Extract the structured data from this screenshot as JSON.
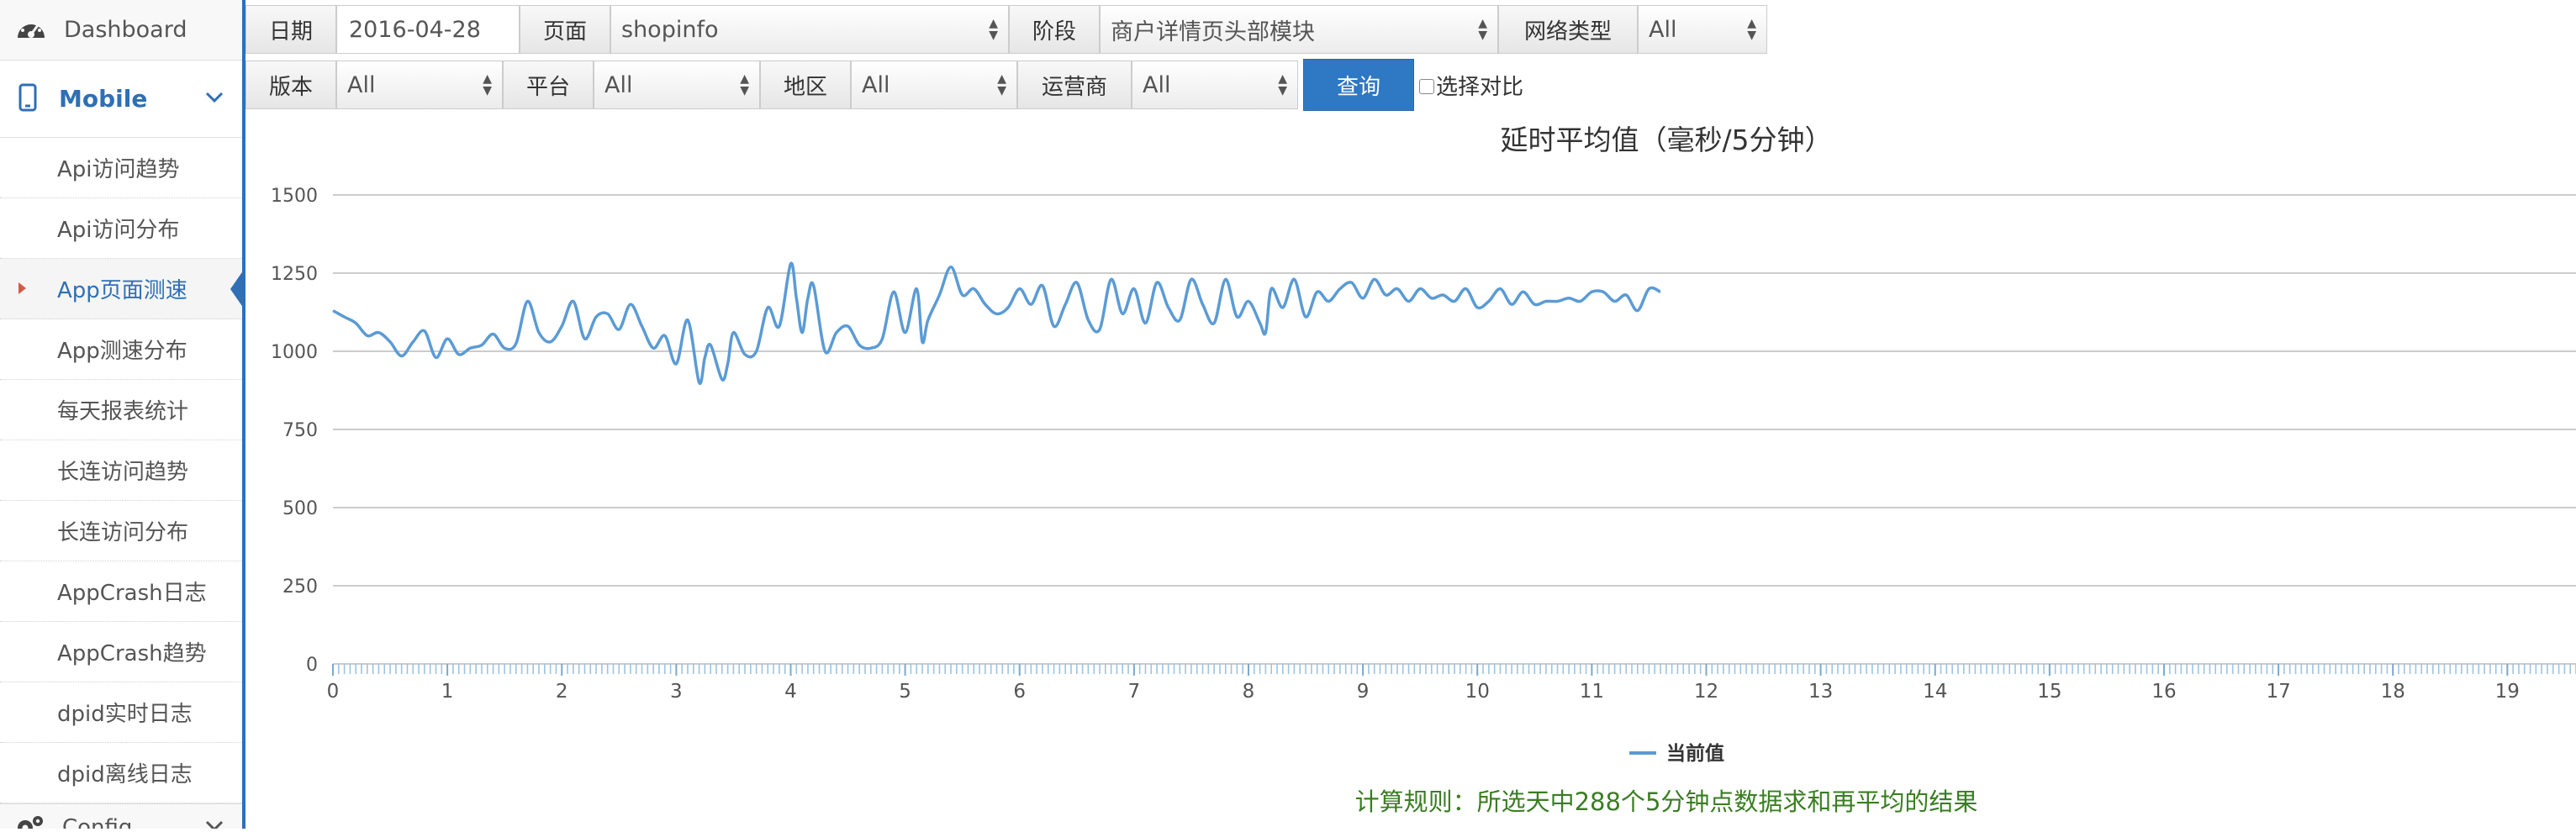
{
  "sidebar": {
    "dashboard": {
      "label": "Dashboard",
      "icon": "dashboard-icon"
    },
    "mobile": {
      "label": "Mobile",
      "icon": "mobile-icon"
    },
    "items": [
      {
        "label": "Api访问趋势"
      },
      {
        "label": "Api访问分布"
      },
      {
        "label": "App页面测速",
        "active": true
      },
      {
        "label": "App测速分布"
      },
      {
        "label": "每天报表统计"
      },
      {
        "label": "长连访问趋势"
      },
      {
        "label": "长连访问分布"
      },
      {
        "label": "AppCrash日志"
      },
      {
        "label": "AppCrash趋势"
      },
      {
        "label": "dpid实时日志"
      },
      {
        "label": "dpid离线日志"
      }
    ],
    "config": {
      "label": "Config",
      "icon": "gear-icon"
    }
  },
  "filters": {
    "date_label": "日期",
    "date_value": "2016-04-28",
    "page_label": "页面",
    "page_value": "shopinfo",
    "stage_label": "阶段",
    "stage_value": "商户详情页头部模块",
    "network_label": "网络类型",
    "network_value": "All",
    "version_label": "版本",
    "version_value": "All",
    "platform_label": "平台",
    "platform_value": "All",
    "region_label": "地区",
    "region_value": "All",
    "carrier_label": "运营商",
    "carrier_value": "All",
    "query_label": "查询",
    "compare_label": "选择对比"
  },
  "colors": {
    "accent": "#2f78c4",
    "line": "#5b9bd5",
    "note": "#3a7d22"
  },
  "chart_data": {
    "type": "line",
    "title": "延时平均值（毫秒/5分钟）",
    "ylim": [
      0,
      1500
    ],
    "yticks": [
      0,
      250,
      500,
      750,
      1000,
      1250,
      1500
    ],
    "xlim": [
      0,
      19.6
    ],
    "xticks": [
      0,
      1,
      2,
      3,
      4,
      5,
      6,
      7,
      8,
      9,
      10,
      11,
      12,
      13,
      14,
      15,
      16,
      17,
      18,
      19
    ],
    "legend_position": "bottom",
    "grid": true,
    "series": [
      {
        "name": "当前值",
        "x": [
          0,
          0.1,
          0.2,
          0.3,
          0.4,
          0.5,
          0.6,
          0.7,
          0.8,
          0.9,
          1.0,
          1.1,
          1.2,
          1.3,
          1.4,
          1.5,
          1.6,
          1.7,
          1.8,
          1.9,
          2.0,
          2.1,
          2.2,
          2.3,
          2.4,
          2.5,
          2.6,
          2.7,
          2.8,
          2.9,
          3.0,
          3.1,
          3.2,
          3.25,
          3.3,
          3.4,
          3.45,
          3.5,
          3.6,
          3.7,
          3.8,
          3.9,
          4.0,
          4.05,
          4.1,
          4.15,
          4.2,
          4.3,
          4.4,
          4.5,
          4.6,
          4.7,
          4.8,
          4.9,
          5.0,
          5.1,
          5.15,
          5.2,
          5.3,
          5.4,
          5.5,
          5.6,
          5.7,
          5.8,
          5.9,
          6.0,
          6.1,
          6.2,
          6.3,
          6.4,
          6.5,
          6.6,
          6.7,
          6.8,
          6.9,
          7.0,
          7.1,
          7.2,
          7.3,
          7.4,
          7.5,
          7.6,
          7.7,
          7.8,
          7.9,
          8.0,
          8.1,
          8.15,
          8.2,
          8.3,
          8.4,
          8.5,
          8.6,
          8.7,
          8.8,
          8.9,
          9.0,
          9.1,
          9.2,
          9.3,
          9.4,
          9.5,
          9.6,
          9.7,
          9.8,
          9.9,
          10.0,
          10.1,
          10.2,
          10.3,
          10.4,
          10.5,
          10.6,
          10.7,
          10.8,
          10.9,
          11.0,
          11.1,
          11.2,
          11.3,
          11.4,
          11.5,
          11.6
        ],
        "values": [
          1130,
          1110,
          1090,
          1050,
          1060,
          1030,
          985,
          1030,
          1065,
          980,
          1040,
          990,
          1010,
          1020,
          1055,
          1010,
          1025,
          1160,
          1060,
          1030,
          1080,
          1160,
          1040,
          1110,
          1120,
          1070,
          1150,
          1080,
          1010,
          1050,
          960,
          1100,
          900,
          980,
          1020,
          910,
          960,
          1060,
          990,
          1000,
          1140,
          1080,
          1280,
          1170,
          1060,
          1170,
          1210,
          1000,
          1060,
          1080,
          1020,
          1010,
          1040,
          1190,
          1060,
          1200,
          1030,
          1100,
          1180,
          1270,
          1180,
          1200,
          1150,
          1120,
          1140,
          1200,
          1150,
          1210,
          1080,
          1150,
          1220,
          1100,
          1070,
          1230,
          1120,
          1200,
          1090,
          1220,
          1140,
          1100,
          1230,
          1150,
          1090,
          1230,
          1110,
          1160,
          1090,
          1060,
          1200,
          1140,
          1230,
          1110,
          1190,
          1160,
          1200,
          1220,
          1170,
          1230,
          1180,
          1200,
          1160,
          1200,
          1170,
          1180,
          1160,
          1200,
          1140,
          1160,
          1200,
          1150,
          1190,
          1150,
          1160,
          1160,
          1170,
          1160,
          1190,
          1190,
          1160,
          1180,
          1130,
          1200,
          1190
        ]
      }
    ],
    "note": "计算规则：所选天中288个5分钟点数据求和再平均的结果"
  }
}
